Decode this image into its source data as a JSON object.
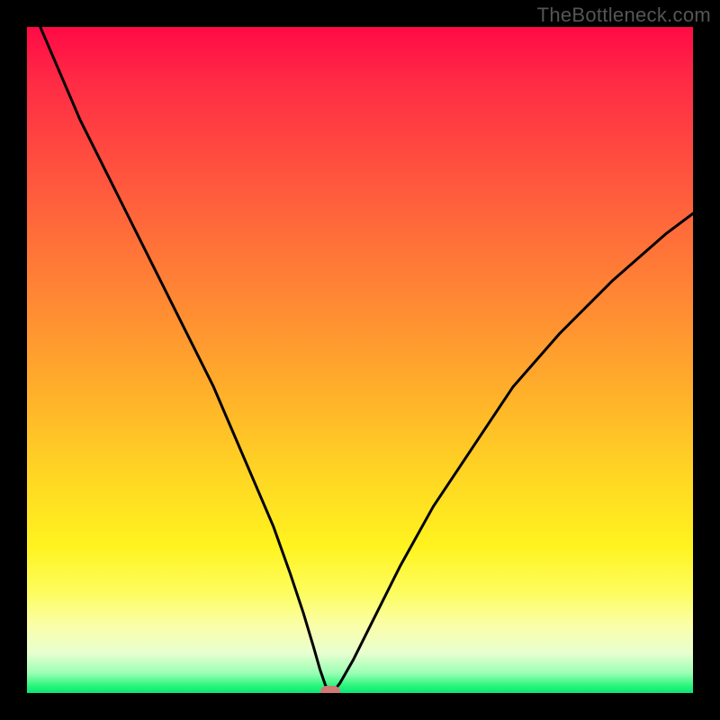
{
  "watermark": "TheBottleneck.com",
  "chart_data": {
    "type": "line",
    "title": "",
    "xlabel": "",
    "ylabel": "",
    "xlim": [
      0,
      100
    ],
    "ylim": [
      0,
      100
    ],
    "grid": false,
    "legend": false,
    "series": [
      {
        "name": "bottleneck-curve",
        "x": [
          2,
          5,
          8,
          12,
          16,
          20,
          24,
          28,
          31,
          34,
          37,
          39.5,
          41.5,
          43,
          44,
          44.8,
          45.3,
          45.6,
          46,
          47,
          49,
          52,
          56,
          61,
          67,
          73,
          80,
          88,
          96,
          100
        ],
        "values": [
          100,
          93,
          86,
          78,
          70,
          62,
          54,
          46,
          39,
          32,
          25,
          18,
          12,
          7,
          3.5,
          1.2,
          0.3,
          0.1,
          0.2,
          1.5,
          5,
          11,
          19,
          28,
          37,
          46,
          54,
          62,
          69,
          72
        ],
        "color": "#000000"
      }
    ],
    "annotations": [
      {
        "name": "minimum-marker",
        "x": 45.5,
        "y": 0.2,
        "color": "#cf7a74"
      }
    ],
    "background_gradient": {
      "orientation": "vertical",
      "stops": [
        {
          "pos": 0.0,
          "color": "#ff0a45"
        },
        {
          "pos": 0.3,
          "color": "#ff6a3a"
        },
        {
          "pos": 0.55,
          "color": "#ffb02a"
        },
        {
          "pos": 0.78,
          "color": "#fff31f"
        },
        {
          "pos": 0.94,
          "color": "#e8ffd0"
        },
        {
          "pos": 1.0,
          "color": "#0de479"
        }
      ]
    }
  }
}
